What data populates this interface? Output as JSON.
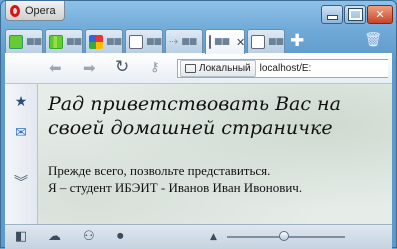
{
  "app": {
    "name": "Opera"
  },
  "tabs": [
    {
      "icon": "page-icon-green",
      "active": false
    },
    {
      "icon": "chart-icon",
      "active": false
    },
    {
      "icon": "google-icon",
      "active": false
    },
    {
      "icon": "document-icon",
      "active": false
    },
    {
      "icon": "arrow-page-icon",
      "active": false
    },
    {
      "icon": "document-icon",
      "active": true
    },
    {
      "icon": "document-icon",
      "active": false
    }
  ],
  "address": {
    "site_label": "Локальный",
    "url": "localhost/E:"
  },
  "page": {
    "heading": "Рад приветствовать Вас на своей домашней страничке",
    "intro_line1": "Прежде всего, позвольте представиться.",
    "intro_line2": "Я – студент ИБЭИТ - Иванов Иван Ивонович."
  },
  "colors": {
    "accent": "#c8432a",
    "chrome": "#6fa9d7",
    "content_bg": "#e6ece8"
  }
}
